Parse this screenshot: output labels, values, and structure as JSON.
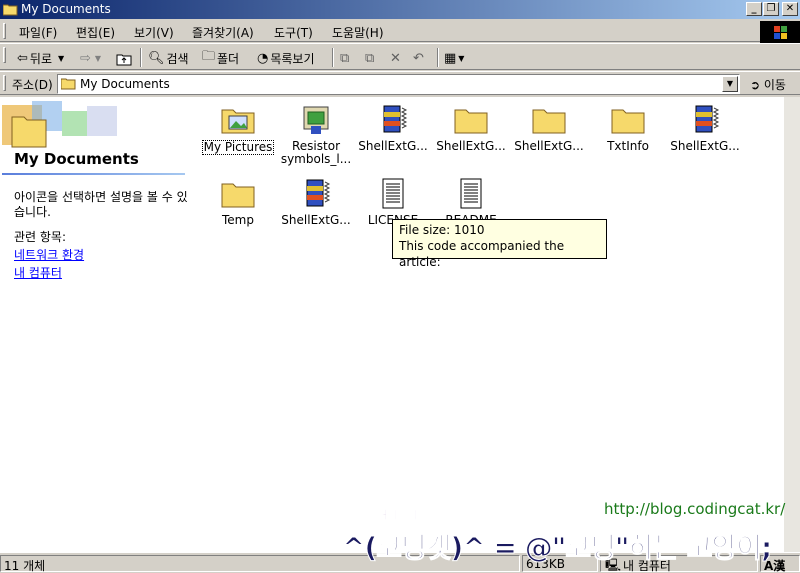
{
  "window": {
    "title": "My Documents",
    "buttons": [
      "_",
      "❐",
      "✕"
    ]
  },
  "menu": {
    "items": [
      "파일(F)",
      "편집(E)",
      "보기(V)",
      "즐겨찾기(A)",
      "도구(T)",
      "도움말(H)"
    ]
  },
  "toolbar": {
    "back_label": "뒤로",
    "search_label": "검색",
    "folders_label": "폴더",
    "history_label": "목록보기"
  },
  "address": {
    "label": "주소(D)",
    "value": "My Documents",
    "go_label": "이동"
  },
  "left_pane": {
    "title": "My Documents",
    "description": "아이콘을 선택하면 설명을 볼 수 있습니다.",
    "related_label": "관련 항목:",
    "links": [
      "네트워크 환경",
      "내 컴퓨터"
    ]
  },
  "files": [
    {
      "name": "My Pictures",
      "icon": "picture-folder-icon",
      "selected": true
    },
    {
      "name": "Resistor symbols_l...",
      "icon": "setup-program-icon"
    },
    {
      "name": "ShellExtG...",
      "icon": "compressed-archive-icon"
    },
    {
      "name": "ShellExtG...",
      "icon": "folder-icon"
    },
    {
      "name": "ShellExtG...",
      "icon": "folder-icon"
    },
    {
      "name": "TxtInfo",
      "icon": "folder-icon"
    },
    {
      "name": "ShellExtG...",
      "icon": "compressed-archive-icon"
    },
    {
      "name": "Temp",
      "icon": "folder-icon"
    },
    {
      "name": "ShellExtG...",
      "icon": "compressed-archive-icon"
    },
    {
      "name": "LICENSE",
      "icon": "text-document-icon"
    },
    {
      "name": "README",
      "icon": "text-document-icon"
    }
  ],
  "tooltip": {
    "line1": "File size: 1010",
    "line2": "This code accompanied the article:"
  },
  "status": {
    "count": "11 개체",
    "size": "613KB",
    "zone": "내 컴퓨터"
  },
  "watermark": {
    "url": "http://blog.codingcat.kr/",
    "main": "^(코딩캣)^ = @\"코딩\"하는 고양이;",
    "top": "ㅋㄴㄷ"
  },
  "colors": {
    "titlebar_start": "#0a246a",
    "titlebar_end": "#a6caf0",
    "link": "#0000ff",
    "tooltip_bg": "#ffffe1",
    "folder_yellow": "#f6d96b"
  }
}
